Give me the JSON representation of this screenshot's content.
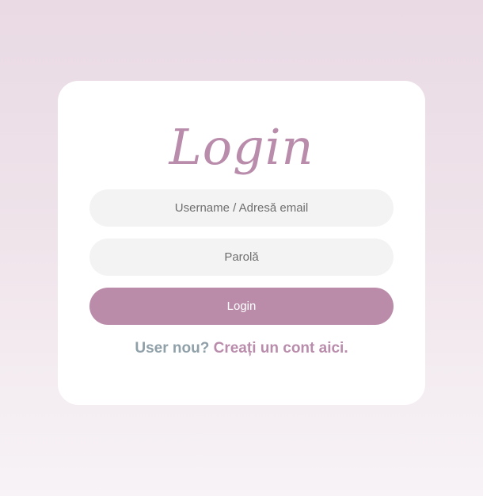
{
  "login_form": {
    "title": "Login",
    "username_placeholder": "Username / Adresă email",
    "password_placeholder": "Parolă",
    "submit_label": "Login",
    "signup_prompt": "User nou?",
    "signup_link": "Creați un cont aici."
  },
  "colors": {
    "accent": "#ba8caa",
    "title": "#b98cab",
    "prompt_text": "#8fa0a8",
    "field_background": "#f3f3f3",
    "card_background": "#ffffff",
    "page_background_top": "#e9dae4",
    "page_background_bottom": "#f7f3f6"
  }
}
